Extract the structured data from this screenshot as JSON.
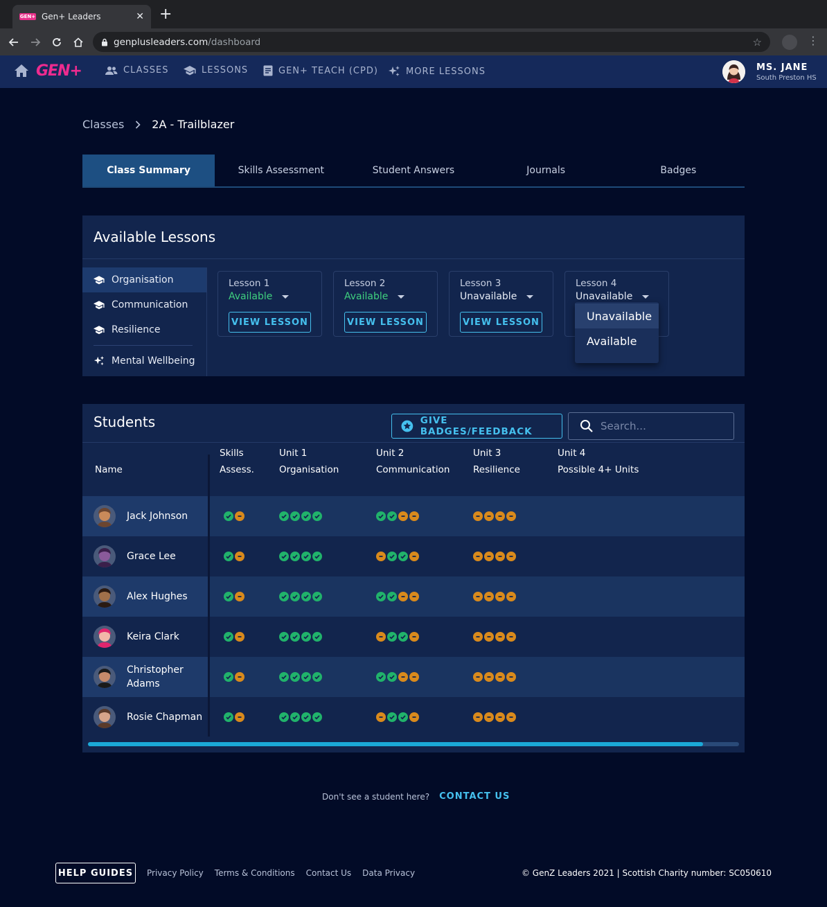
{
  "browser": {
    "tab_title": "Gen+ Leaders",
    "favicon_text": "GEN+",
    "close_glyph": "✕",
    "new_tab_glyph": "+",
    "url_host": "genplusleaders.com",
    "url_path": "/dashboard"
  },
  "nav": {
    "logo": "GEN+",
    "items": [
      "CLASSES",
      "LESSONS",
      "GEN+ TEACH (CPD)",
      "MORE LESSONS"
    ],
    "user_name": "MS. JANE",
    "user_school": "South Preston HS"
  },
  "breadcrumb": {
    "parent": "Classes",
    "current": "2A - Trailblazer"
  },
  "tabs": [
    "Class Summary",
    "Skills Assessment",
    "Student Answers",
    "Journals",
    "Badges"
  ],
  "lessons_panel": {
    "title": "Available Lessons",
    "subjects": [
      "Organisation",
      "Communication",
      "Resilience",
      "Mental Wellbeing"
    ],
    "lessons": [
      {
        "title": "Lesson 1",
        "status": "Available",
        "button": "VIEW LESSON"
      },
      {
        "title": "Lesson 2",
        "status": "Available",
        "button": "VIEW LESSON"
      },
      {
        "title": "Lesson 3",
        "status": "Unavailable",
        "button": "VIEW LESSON"
      },
      {
        "title": "Lesson 4",
        "status": "Unavailable"
      }
    ],
    "dropdown_options": [
      "Unavailable",
      "Available"
    ],
    "colors": {
      "available": "#3fd07e",
      "unavailable": "#e6ebf5"
    }
  },
  "students_panel": {
    "title": "Students",
    "badge_button": "GIVE BADGES/FEEDBACK",
    "search_placeholder": "Search...",
    "columns": {
      "name": "Name",
      "skills_1": "Skills",
      "skills_2": "Assess.",
      "u1_1": "Unit 1",
      "u1_2": "Organisation",
      "u2_1": "Unit 2",
      "u2_2": "Communication",
      "u3_1": "Unit 3",
      "u3_2": "Resilience",
      "u4_1": "Unit 4",
      "u4_2": "Possible 4+ Units"
    },
    "students": [
      {
        "name": "Jack Johnson",
        "skills": "go",
        "u1": "gggg",
        "u2": "ggoo",
        "u3": "oooo"
      },
      {
        "name": "Grace Lee",
        "skills": "go",
        "u1": "gggg",
        "u2": "oggo",
        "u3": "oooo"
      },
      {
        "name": "Alex Hughes",
        "skills": "go",
        "u1": "gggg",
        "u2": "ggoo",
        "u3": "oooo"
      },
      {
        "name": "Keira Clark",
        "skills": "go",
        "u1": "gggg",
        "u2": "oggo",
        "u3": "oooo"
      },
      {
        "name": "Christopher Adams",
        "skills": "go",
        "u1": "gggg",
        "u2": "ggoo",
        "u3": "oooo"
      },
      {
        "name": "Rosie Chapman",
        "skills": "go",
        "u1": "gggg",
        "u2": "oggo",
        "u3": "oooo"
      }
    ],
    "scroll_fraction": 0.945
  },
  "cta": {
    "question": "Don't see a student here?",
    "link": "CONTACT US"
  },
  "footer": {
    "help": "HELP GUIDES",
    "links": [
      "Privacy Policy",
      "Terms & Conditions",
      "Contact Us",
      "Data Privacy"
    ],
    "copyright": "© GenZ Leaders 2021 | Scottish Charity number: SC050610"
  }
}
